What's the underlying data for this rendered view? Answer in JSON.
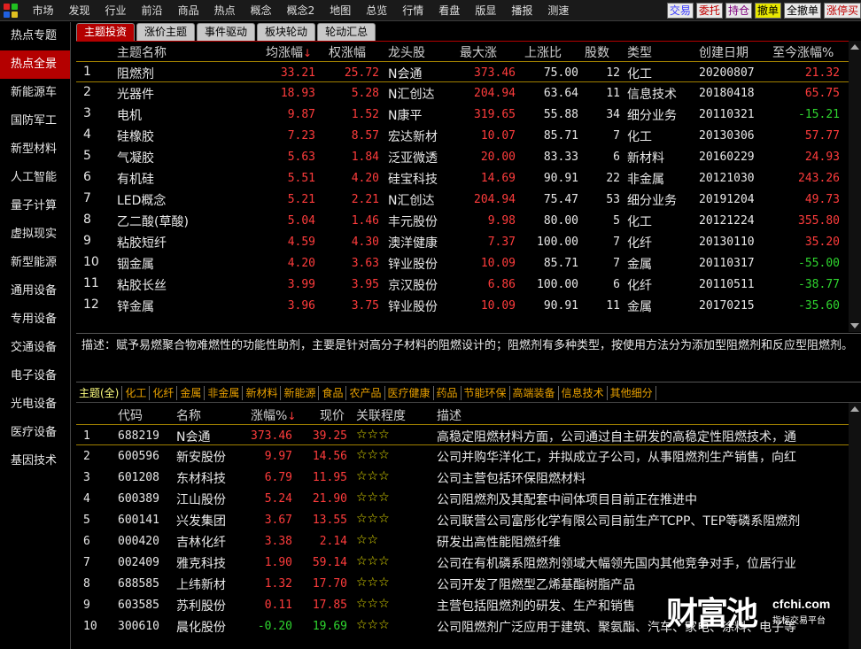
{
  "logo_colors": [
    "#e02020",
    "#20c020",
    "#2060e0",
    "#e0c020"
  ],
  "menu": [
    "市场",
    "发现",
    "行业",
    "前沿",
    "商品",
    "热点",
    "概念",
    "概念2",
    "地图",
    "总览",
    "行情",
    "看盘",
    "版显",
    "播报",
    "测速"
  ],
  "trade_buttons": [
    {
      "label": "交易",
      "color": "#3a3aff",
      "bg": "#e8e8e8"
    },
    {
      "label": "委托",
      "color": "#c00000",
      "bg": "#e8e8e8"
    },
    {
      "label": "持仓",
      "color": "#800080",
      "bg": "#e8e8e8"
    },
    {
      "label": "撤单",
      "color": "#000",
      "bg": "#e8e800"
    },
    {
      "label": "全撤单",
      "color": "#000",
      "bg": "#e8e8e8"
    },
    {
      "label": "涨停买",
      "color": "#c00000",
      "bg": "#e8e8e8"
    }
  ],
  "sidebar": [
    "热点专题",
    "热点全景",
    "新能源车",
    "国防军工",
    "新型材料",
    "人工智能",
    "量子计算",
    "虚拟现实",
    "新型能源",
    "通用设备",
    "专用设备",
    "交通设备",
    "电子设备",
    "光电设备",
    "医疗设备",
    "基因技术"
  ],
  "sidebar_active": 1,
  "tabs": [
    "主题投资",
    "涨价主题",
    "事件驱动",
    "板块轮动",
    "轮动汇总"
  ],
  "tabs_active": 0,
  "topic_headers": {
    "idx": "",
    "name": "主题名称",
    "avg": "均涨幅",
    "sort_arrow": "↓",
    "wavg": "权涨幅",
    "leader": "龙头股",
    "max": "最大涨",
    "ratio": "上涨比",
    "count": "股数",
    "type": "类型",
    "date": "创建日期",
    "cum": "至今涨幅%"
  },
  "topics": [
    {
      "idx": "1",
      "name": "阻燃剂",
      "avg": "33.21",
      "wavg": "25.72",
      "leader": "N会通",
      "max": "373.46",
      "ratio": "75.00",
      "count": "12",
      "type": "化工",
      "date": "20200807",
      "cum": "21.32",
      "cum_dir": "up"
    },
    {
      "idx": "2",
      "name": "光器件",
      "avg": "18.93",
      "wavg": "5.28",
      "leader": "N汇创达",
      "max": "204.94",
      "ratio": "63.64",
      "count": "11",
      "type": "信息技术",
      "date": "20180418",
      "cum": "65.75",
      "cum_dir": "up"
    },
    {
      "idx": "3",
      "name": "电机",
      "avg": "9.87",
      "wavg": "1.52",
      "leader": "N康平",
      "max": "319.65",
      "ratio": "55.88",
      "count": "34",
      "type": "细分业务",
      "date": "20110321",
      "cum": "-15.21",
      "cum_dir": "down"
    },
    {
      "idx": "4",
      "name": "硅橡胶",
      "avg": "7.23",
      "wavg": "8.57",
      "leader": "宏达新材",
      "max": "10.07",
      "ratio": "85.71",
      "count": "7",
      "type": "化工",
      "date": "20130306",
      "cum": "57.77",
      "cum_dir": "up"
    },
    {
      "idx": "5",
      "name": "气凝胶",
      "avg": "5.63",
      "wavg": "1.84",
      "leader": "泛亚微透",
      "max": "20.00",
      "ratio": "83.33",
      "count": "6",
      "type": "新材料",
      "date": "20160229",
      "cum": "24.93",
      "cum_dir": "up"
    },
    {
      "idx": "6",
      "name": "有机硅",
      "avg": "5.51",
      "wavg": "4.20",
      "leader": "硅宝科技",
      "max": "14.69",
      "ratio": "90.91",
      "count": "22",
      "type": "非金属",
      "date": "20121030",
      "cum": "243.26",
      "cum_dir": "up"
    },
    {
      "idx": "7",
      "name": "LED概念",
      "avg": "5.21",
      "wavg": "2.21",
      "leader": "N汇创达",
      "max": "204.94",
      "ratio": "75.47",
      "count": "53",
      "type": "细分业务",
      "date": "20191204",
      "cum": "49.73",
      "cum_dir": "up"
    },
    {
      "idx": "8",
      "name": "乙二酸(草酸)",
      "avg": "5.04",
      "wavg": "1.46",
      "leader": "丰元股份",
      "max": "9.98",
      "ratio": "80.00",
      "count": "5",
      "type": "化工",
      "date": "20121224",
      "cum": "355.80",
      "cum_dir": "up"
    },
    {
      "idx": "9",
      "name": "粘胶短纤",
      "avg": "4.59",
      "wavg": "4.30",
      "leader": "澳洋健康",
      "max": "7.37",
      "ratio": "100.00",
      "count": "7",
      "type": "化纤",
      "date": "20130110",
      "cum": "35.20",
      "cum_dir": "up"
    },
    {
      "idx": "10",
      "name": "铟金属",
      "avg": "4.20",
      "wavg": "3.63",
      "leader": "锌业股份",
      "max": "10.09",
      "ratio": "85.71",
      "count": "7",
      "type": "金属",
      "date": "20110317",
      "cum": "-55.00",
      "cum_dir": "down"
    },
    {
      "idx": "11",
      "name": "粘胶长丝",
      "avg": "3.99",
      "wavg": "3.95",
      "leader": "京汉股份",
      "max": "6.86",
      "ratio": "100.00",
      "count": "6",
      "type": "化纤",
      "date": "20110511",
      "cum": "-38.77",
      "cum_dir": "down"
    },
    {
      "idx": "12",
      "name": "锌金属",
      "avg": "3.96",
      "wavg": "3.75",
      "leader": "锌业股份",
      "max": "10.09",
      "ratio": "90.91",
      "count": "11",
      "type": "金属",
      "date": "20170215",
      "cum": "-35.60",
      "cum_dir": "down"
    }
  ],
  "description": "描述：赋予易燃聚合物难燃性的功能性助剂，主要是针对高分子材料的阻燃设计的；阻燃剂有多种类型，按使用方法分为添加型阻燃剂和反应型阻燃剂。",
  "categories": [
    "主题(全)",
    "化工",
    "化纤",
    "金属",
    "非金属",
    "新材料",
    "新能源",
    "食品",
    "农产品",
    "医疗健康",
    "药品",
    "节能环保",
    "高端装备",
    "信息技术",
    "其他细分"
  ],
  "categories_active": 0,
  "stock_headers": {
    "idx": "",
    "code": "代码",
    "name": "名称",
    "pct": "涨幅%",
    "sort_arrow": "↓",
    "price": "现价",
    "rel": "关联程度",
    "desc": "描述"
  },
  "stocks": [
    {
      "idx": "1",
      "code": "688219",
      "name": "N会通",
      "pct": "373.46",
      "price": "39.25",
      "rel": "☆☆☆",
      "dir": "up",
      "desc": "高稳定阻燃材料方面，公司通过自主研发的高稳定性阻燃技术，通"
    },
    {
      "idx": "2",
      "code": "600596",
      "name": "新安股份",
      "pct": "9.97",
      "price": "14.56",
      "rel": "☆☆☆",
      "dir": "up",
      "desc": "公司并购华洋化工，并拟成立子公司，从事阻燃剂生产销售，向红"
    },
    {
      "idx": "3",
      "code": "601208",
      "name": "东材科技",
      "pct": "6.79",
      "price": "11.95",
      "rel": "☆☆☆",
      "dir": "up",
      "desc": "公司主营包括环保阻燃材料"
    },
    {
      "idx": "4",
      "code": "600389",
      "name": "江山股份",
      "pct": "5.24",
      "price": "21.90",
      "rel": "☆☆☆",
      "dir": "up",
      "desc": "公司阻燃剂及其配套中间体项目目前正在推进中"
    },
    {
      "idx": "5",
      "code": "600141",
      "name": "兴发集团",
      "pct": "3.67",
      "price": "13.55",
      "rel": "☆☆☆",
      "dir": "up",
      "desc": "公司联营公司富彤化学有限公司目前生产TCPP、TEP等磷系阻燃剂"
    },
    {
      "idx": "6",
      "code": "000420",
      "name": "吉林化纤",
      "pct": "3.38",
      "price": "2.14",
      "rel": "☆☆",
      "dir": "up",
      "desc": "研发出高性能阻燃纤维"
    },
    {
      "idx": "7",
      "code": "002409",
      "name": "雅克科技",
      "pct": "1.90",
      "price": "59.14",
      "rel": "☆☆☆",
      "dir": "up",
      "desc": "公司在有机磷系阻燃剂领域大幅领先国内其他竞争对手，位居行业"
    },
    {
      "idx": "8",
      "code": "688585",
      "name": "上纬新材",
      "pct": "1.32",
      "price": "17.70",
      "rel": "☆☆☆",
      "dir": "up",
      "desc": "公司开发了阻燃型乙烯基酯树脂产品"
    },
    {
      "idx": "9",
      "code": "603585",
      "name": "苏利股份",
      "pct": "0.11",
      "price": "17.85",
      "rel": "☆☆☆",
      "dir": "up",
      "desc": "主营包括阻燃剂的研发、生产和销售"
    },
    {
      "idx": "10",
      "code": "300610",
      "name": "晨化股份",
      "pct": "-0.20",
      "price": "19.69",
      "rel": "☆☆☆",
      "dir": "down",
      "desc": "公司阻燃剂广泛应用于建筑、聚氨酯、汽车、家电、涂料、电子等"
    }
  ],
  "watermark": {
    "cn": "财富池",
    "en": "cfchi.com",
    "sub": "指标交易平台"
  }
}
